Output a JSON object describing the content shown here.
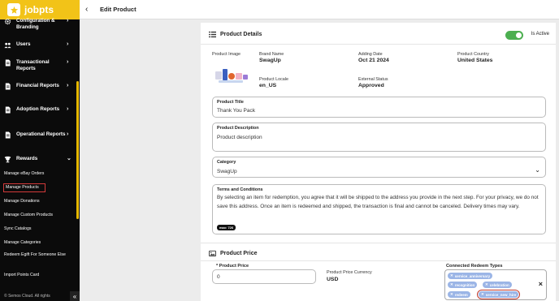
{
  "brand": {
    "name": "jobpts"
  },
  "sidebar": {
    "items": [
      {
        "label": "Configuration & Branding",
        "icon": "gear-icon"
      },
      {
        "label": "Users",
        "icon": "users-icon"
      },
      {
        "label": "Transactional Reports",
        "icon": "report-icon"
      },
      {
        "label": "Financial Reports",
        "icon": "report-icon"
      },
      {
        "label": "Adoption Reports",
        "icon": "report-icon"
      },
      {
        "label": "Operational Reports",
        "icon": "report-icon"
      },
      {
        "label": "Rewards",
        "icon": "trophy-icon"
      }
    ],
    "subitems": [
      {
        "label": "Manage eBay Orders"
      },
      {
        "label": "Manage Products",
        "active": true
      },
      {
        "label": "Manage Donations"
      },
      {
        "label": "Manage Custom Products"
      },
      {
        "label": "Sync Catalogs"
      },
      {
        "label": "Manage Categories"
      },
      {
        "label": "Redeem Egift For Someone Else"
      },
      {
        "label": "Import Points Card"
      }
    ],
    "footer": "© Semos Cloud. All rights"
  },
  "topbar": {
    "title": "Edit Product"
  },
  "details": {
    "heading": "Product Details",
    "active_label": "Is Active",
    "is_active": true,
    "image_label": "Product Image",
    "brand_label": "Brand Name",
    "brand_value": "SwagUp",
    "adding_date_label": "Adding Date",
    "adding_date_value": "Oct 21 2024",
    "country_label": "Product Country",
    "country_value": "United States",
    "locale_label": "Product Locale",
    "locale_value": "en_US",
    "external_status_label": "External Status",
    "external_status_value": "Approved"
  },
  "form": {
    "title_label": "Product Title",
    "title_value": "Thank You Pack",
    "description_label": "Product Description",
    "description_value": "Product description",
    "category_label": "Category",
    "category_value": "SwagUp",
    "terms_label": "Terms and Conditions",
    "terms_value": "By selecting an item for redemption, you agree that it will be shipped to the address you provide in the next step. For your privacy, we do not save this address. Once an item is redeemed and shipped, the transaction is final and cannot be canceled. Delivery times may vary.",
    "terms_counter": "max: 726"
  },
  "price": {
    "heading": "Product Price",
    "price_label": "* Product Price",
    "price_value": "0",
    "currency_label": "Product Price Currency",
    "currency_value": "USD",
    "redeem_types_label": "Connected Redeem Types",
    "redeem_types": [
      "service_anniversary",
      "recognition",
      "celebration",
      "redeem",
      "service_new_hire"
    ]
  }
}
